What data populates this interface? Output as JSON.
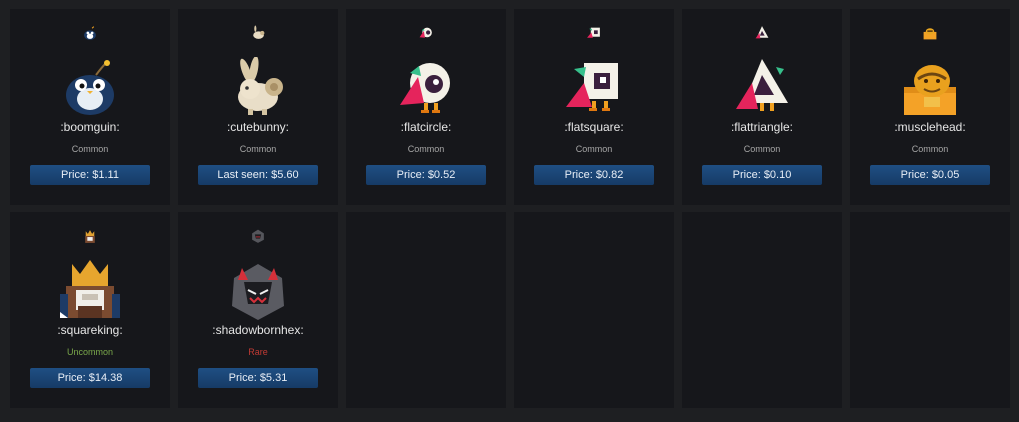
{
  "items": [
    {
      "name": ":boomguin:",
      "rarity": "Common",
      "price": "Price: $1.11"
    },
    {
      "name": ":cutebunny:",
      "rarity": "Common",
      "price": "Last seen: $5.60"
    },
    {
      "name": ":flatcircle:",
      "rarity": "Common",
      "price": "Price: $0.52"
    },
    {
      "name": ":flatsquare:",
      "rarity": "Common",
      "price": "Price: $0.82"
    },
    {
      "name": ":flattriangle:",
      "rarity": "Common",
      "price": "Price: $0.10"
    },
    {
      "name": ":musclehead:",
      "rarity": "Common",
      "price": "Price: $0.05"
    },
    {
      "name": ":squareking:",
      "rarity": "Uncommon",
      "price": "Price: $14.38"
    },
    {
      "name": ":shadowbornhex:",
      "rarity": "Rare",
      "price": "Price: $5.31"
    }
  ],
  "rarity_colors": {
    "Common": "#a7a7a7",
    "Uncommon": "#7aa84b",
    "Rare": "#c13a34"
  }
}
